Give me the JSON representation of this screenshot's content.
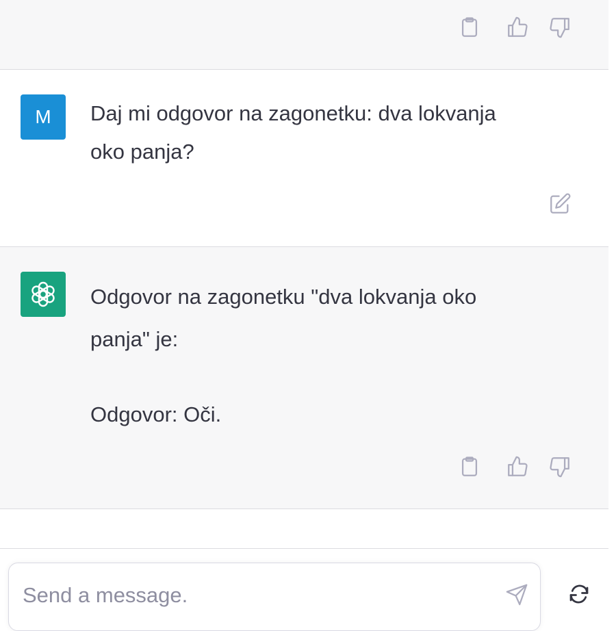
{
  "messages": [
    {
      "role": "user",
      "avatar_letter": "M",
      "lines": [
        "Daj mi odgovor na zagonetku: dva lokvanja",
        "oko panja?"
      ],
      "actions": [
        "edit-icon"
      ]
    },
    {
      "role": "assistant",
      "avatar_icon": "openai-logo-icon",
      "lines": [
        "Odgovor na zagonetku \"dva lokvanja oko",
        "panja\" je:",
        "",
        "Odgovor: Oči."
      ],
      "actions": [
        "clipboard-icon",
        "thumbs-up-icon",
        "thumbs-down-icon"
      ]
    }
  ],
  "composer": {
    "placeholder": "Send a message.",
    "value": ""
  },
  "colors": {
    "user_avatar": "#1a8fd6",
    "assistant_avatar": "#19a37f",
    "assistant_bg": "#f7f7f8",
    "text": "#343541",
    "icon": "#acacbe"
  }
}
